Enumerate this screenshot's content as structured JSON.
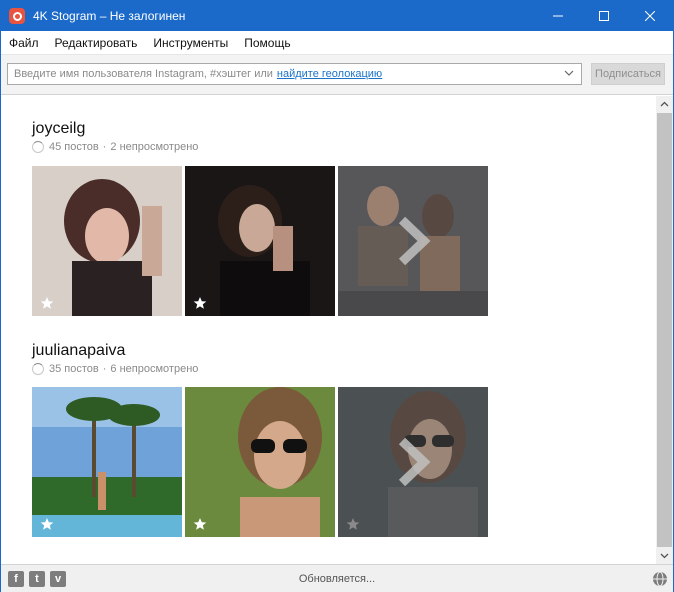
{
  "window": {
    "title": "4K Stogram – Не залогинен",
    "minimize_glyph": "—",
    "maximize_glyph": "☐",
    "close_glyph": "✕"
  },
  "menu": [
    "Файл",
    "Редактировать",
    "Инструменты",
    "Помощь"
  ],
  "search": {
    "placeholder": "Введите имя пользователя Instagram, #хэштег или",
    "geo_link": "найдите геолокацию",
    "subscribe_label": "Подписаться"
  },
  "accounts": [
    {
      "name": "joyceilg",
      "posts": "45 постов",
      "separator": "·",
      "unseen": "2 непросмотрено",
      "photos": [
        {
          "icon": "star-icon",
          "has_star": true,
          "is_more": false,
          "palette": [
            "#d8cfc8",
            "#5a3a34"
          ]
        },
        {
          "icon": "star-icon",
          "has_star": true,
          "is_more": false,
          "palette": [
            "#1a1616",
            "#c9a898"
          ]
        },
        {
          "icon": "chevron-right-icon",
          "has_star": false,
          "is_more": true,
          "palette": [
            "#3a3a3e",
            "#6a5040"
          ]
        }
      ]
    },
    {
      "name": "juulianapaiva",
      "posts": "35 постов",
      "separator": "·",
      "unseen": "6 непросмотрено",
      "photos": [
        {
          "icon": "star-icon",
          "has_star": true,
          "is_more": false,
          "palette": [
            "#6fa2d8",
            "#2f6a2a"
          ]
        },
        {
          "icon": "star-icon",
          "has_star": true,
          "is_more": false,
          "palette": [
            "#6b8a3e",
            "#d4a88a"
          ]
        },
        {
          "icon": "chevron-right-icon",
          "has_star": false,
          "is_more": true,
          "palette": [
            "#2c3236",
            "#5a4a40"
          ]
        }
      ]
    }
  ],
  "status": {
    "text": "Обновляется...",
    "social": [
      {
        "name": "facebook-icon",
        "glyph": "f"
      },
      {
        "name": "twitter-icon",
        "glyph": "t"
      },
      {
        "name": "vimeo-icon",
        "glyph": "v"
      }
    ]
  },
  "colors": {
    "titlebar": "#1b6ac9",
    "link": "#1a73c9",
    "app_icon": "#e8543f"
  }
}
